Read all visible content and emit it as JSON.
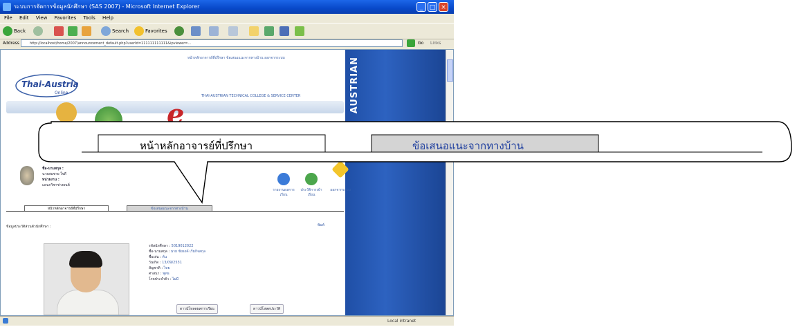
{
  "browser": {
    "title": "ระบบการจัดการข้อมูลนักศึกษา (SAS 2007) - Microsoft Internet Explorer",
    "menu": [
      "File",
      "Edit",
      "View",
      "Favorites",
      "Tools",
      "Help"
    ],
    "toolbar": {
      "back": "Back",
      "search": "Search",
      "favorites": "Favorites"
    },
    "address_label": "Address",
    "address_value": "http://localhost/home/2007/announcement_default.php?userId=111111111111&ipviewer=...",
    "go_label": "Go",
    "links_label": "Links",
    "status_zone": "Local intranet"
  },
  "page": {
    "top_links": "หน้าหลักอาจารย์ที่ปรึกษา   ข้อเสนอแนะจากทางบ้าน   ออกจากระบบ",
    "logo_text": "Thai-Austrian",
    "logo_sub": "Online",
    "college": "THAI-AUSTRIAN TECHNICAL COLLEGE & SERVICE CENTER",
    "side_text": "AUSTRIAN",
    "profile": {
      "name_label": "ชื่อ-นามสกุล :",
      "name_value": "นายสมชาย ใจดี",
      "dept_label": "หน่วยงาน :",
      "dept_value": "แผนกวิชาช่างยนต์"
    },
    "menu_icons": [
      {
        "label": "รายงานผลการเรียน"
      },
      {
        "label": "ประวัติการเข้าเรียน"
      },
      {
        "label": "ออกจากระบบ"
      }
    ],
    "small_tabs": [
      "หน้าหลักอาจารย์ที่ปรึกษา",
      "ข้อเสนอแนะจากทางบ้าน"
    ],
    "info_heading": "ข้อมูลประวัติส่วนตัวนักศึกษา :",
    "print_label": "พิมพ์",
    "details": [
      {
        "k": "รหัสนักศึกษา :",
        "v": "5019012022"
      },
      {
        "k": "ชื่อ-นามสกุล :",
        "v": "นาย ชัยธงค์ เริ่มกิจสกุล"
      },
      {
        "k": "ชื่อเล่น :",
        "v": "ต้น"
      },
      {
        "k": "วันเกิด :",
        "v": "13/09/2531"
      },
      {
        "k": "สัญชาติ :",
        "v": "ไทย"
      },
      {
        "k": "ศาสนา :",
        "v": "พุทธ"
      },
      {
        "k": "โรคประจำตัว :",
        "v": "ไม่มี"
      }
    ],
    "action_buttons": [
      "ดาวน์โหลดผลการเรียน",
      "ดาวน์โหลดประวัติ"
    ]
  },
  "zoom": {
    "tab_active": "หน้าหลักอาจารย์ที่ปรึกษา",
    "tab_inactive": "ข้อเสนอแนะจากทางบ้าน"
  }
}
